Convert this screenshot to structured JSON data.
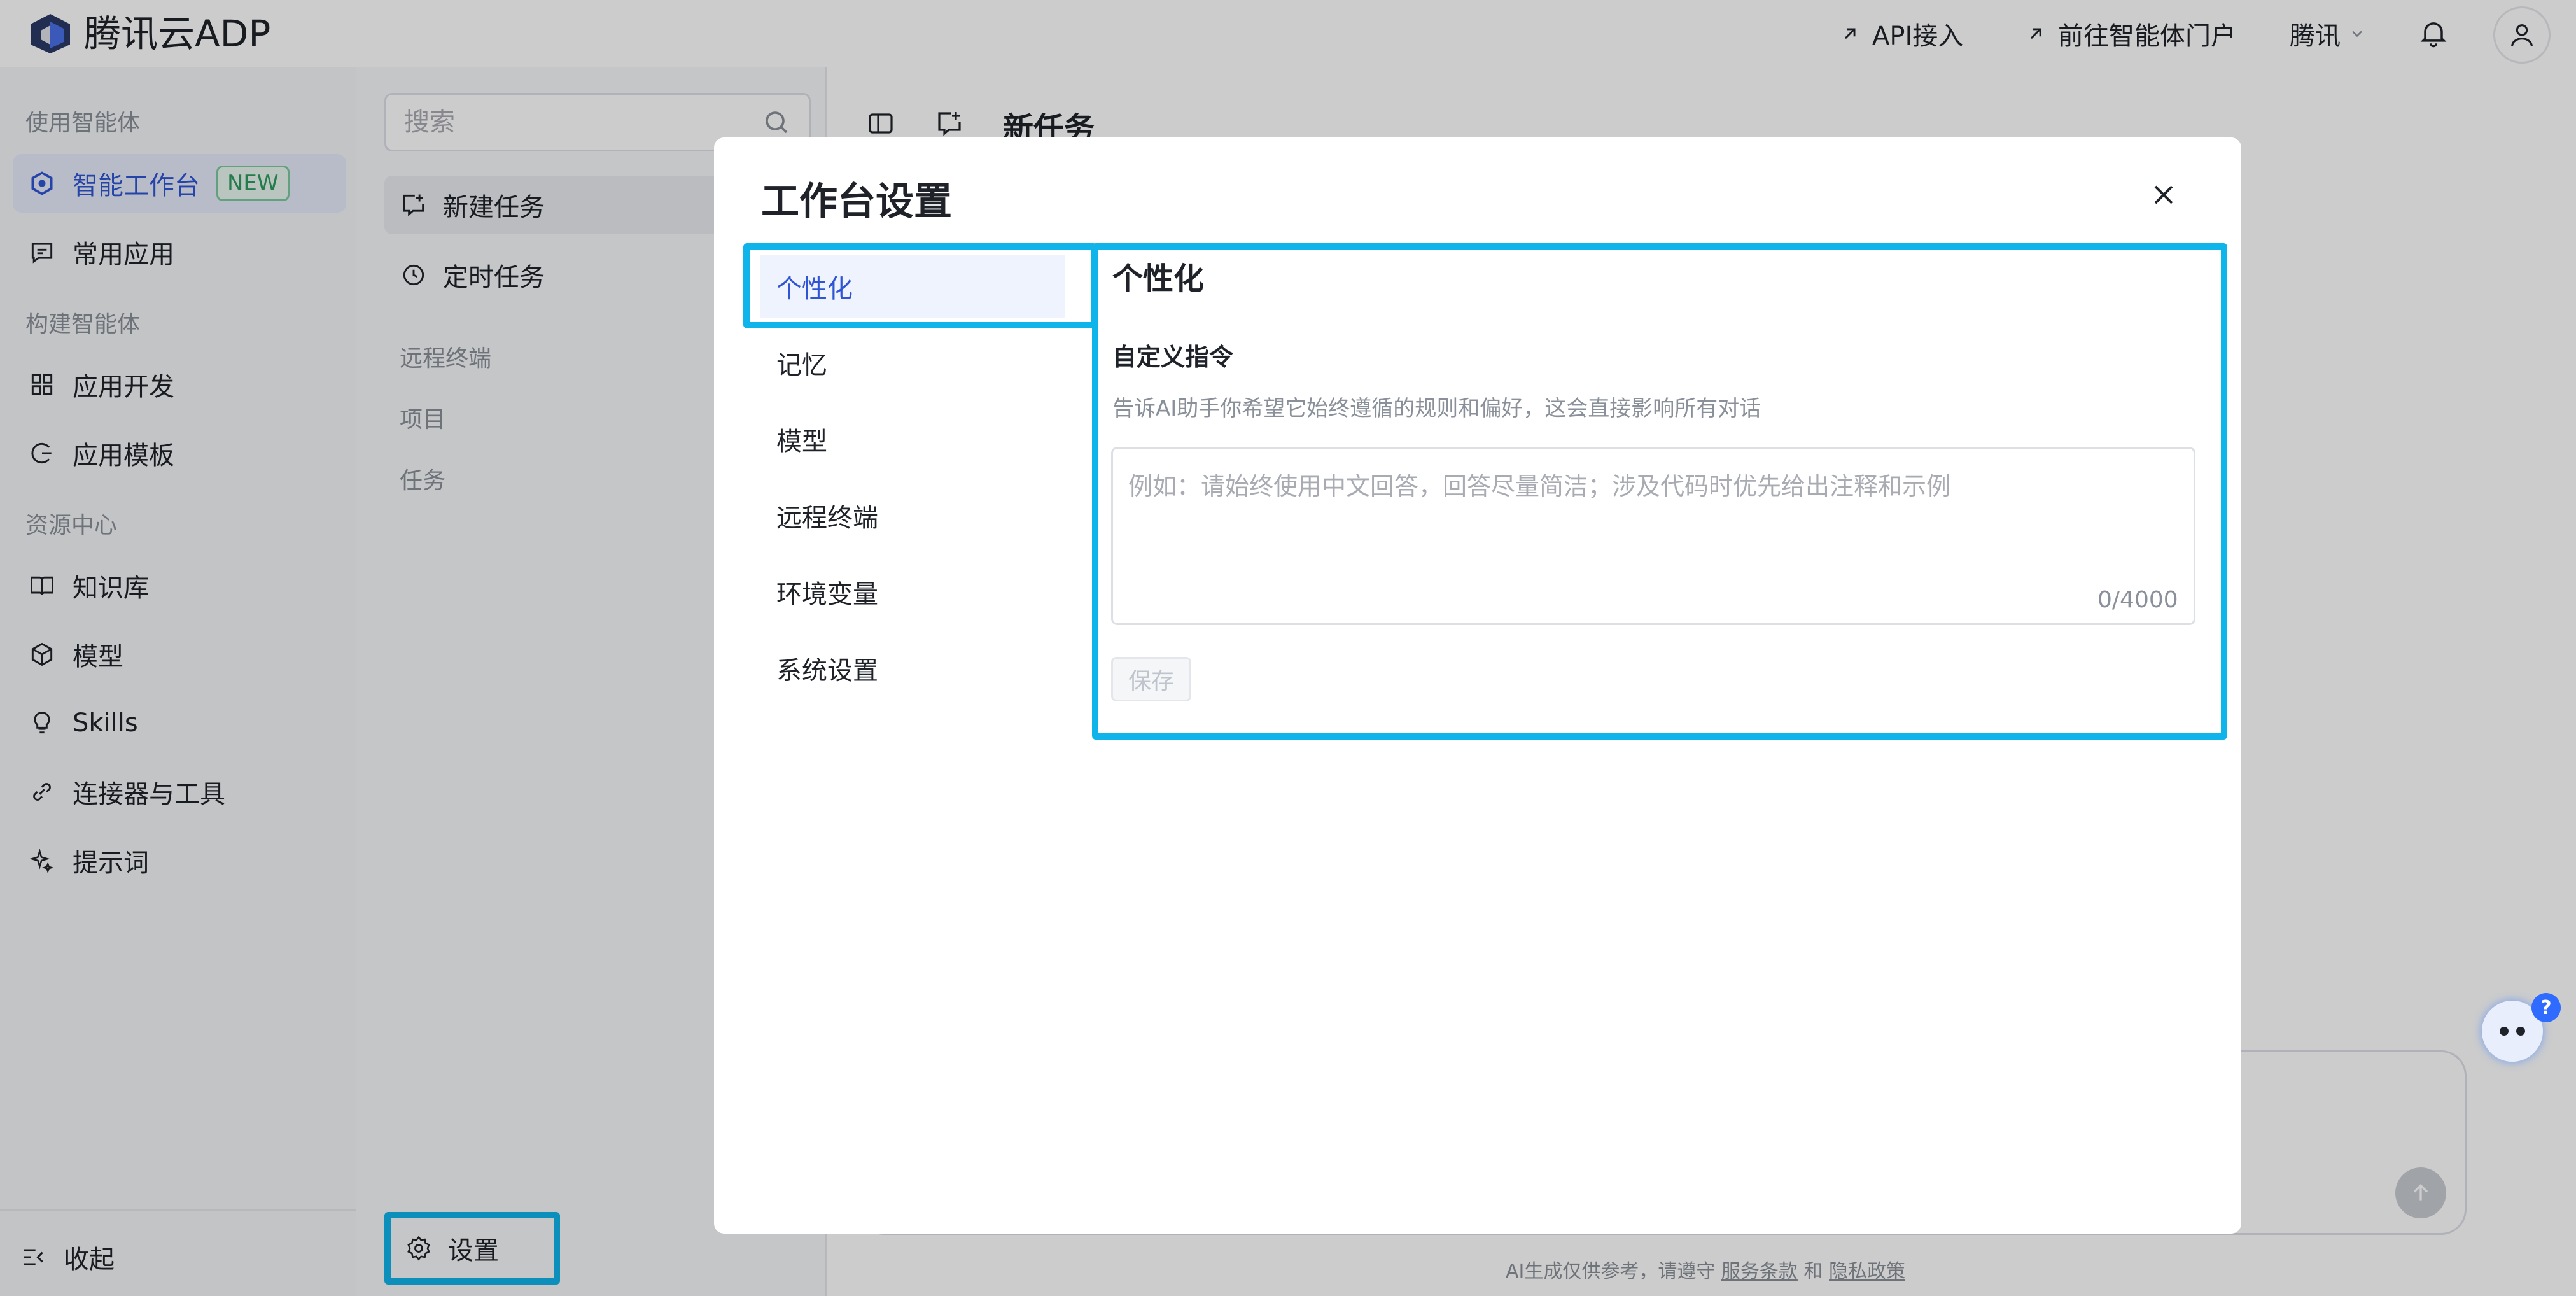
{
  "topbar": {
    "brand": "腾讯云ADP",
    "api_link": "API接入",
    "portal_link": "前往智能体门户",
    "org": "腾讯"
  },
  "sidebar": {
    "section_use": "使用智能体",
    "workbench": "智能工作台",
    "workbench_badge": "NEW",
    "common_apps": "常用应用",
    "section_build": "构建智能体",
    "app_dev": "应用开发",
    "app_templates": "应用模板",
    "section_resources": "资源中心",
    "knowledge": "知识库",
    "models": "模型",
    "skills": "Skills",
    "connectors": "连接器与工具",
    "prompts": "提示词",
    "collapse": "收起"
  },
  "tasks_panel": {
    "search_placeholder": "搜索",
    "new_task": "新建任务",
    "scheduled_task": "定时任务",
    "remote_terminal": "远程终端",
    "project": "项目",
    "tasks": "任务",
    "settings": "设置"
  },
  "main": {
    "title": "新任务",
    "disclaimer_prefix": "AI生成仅供参考，请遵守",
    "terms": "服务条款",
    "and": "和",
    "privacy": "隐私政策"
  },
  "modal": {
    "title": "工作台设置",
    "tabs": [
      "个性化",
      "记忆",
      "模型",
      "远程终端",
      "环境变量",
      "系统设置"
    ],
    "active_tab": "个性化",
    "panel_title": "个性化",
    "field_label": "自定义指令",
    "field_desc": "告诉AI助手你希望它始终遵循的规则和偏好，这会直接影响所有对话",
    "textarea_placeholder": "例如：请始终使用中文回答，回答尽量简洁；涉及代码时优先给出注释和示例",
    "counter": "0/4000",
    "save": "保存"
  },
  "assistant": {
    "help_badge": "?"
  },
  "colors": {
    "accent": "#2f55d4",
    "highlight": "#0fb5ea",
    "new_badge": "#2e9a5f"
  }
}
